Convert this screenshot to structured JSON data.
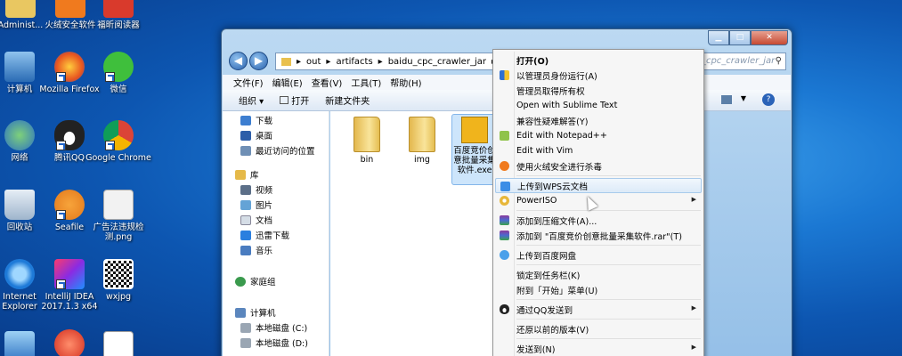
{
  "desktop": {
    "row0": [
      "Administ...",
      "火绒安全软件",
      "福昕阅读器"
    ],
    "row1": [
      "计算机",
      "Mozilla Firefox",
      "微信"
    ],
    "row2": [
      "网络",
      "腾讯QQ",
      "Google Chrome"
    ],
    "row3": [
      "回收站",
      "Seafile",
      "广告法违规检测.png"
    ],
    "row4": [
      "Internet Explorer",
      "IntelliJ IDEA 2017.1.3 x64",
      "wxjpg"
    ]
  },
  "window": {
    "breadcrumb": [
      "out",
      "artifacts",
      "baidu_cpc_crawler_jar"
    ],
    "search_placeholder": "baidu_cpc_crawler_jar",
    "menu": [
      "文件(F)",
      "编辑(E)",
      "查看(V)",
      "工具(T)",
      "帮助(H)"
    ],
    "toolbar": [
      "组织 ▾",
      "打开",
      "新建文件夹"
    ],
    "nav": [
      "下载",
      "桌面",
      "最近访问的位置",
      "库",
      "视频",
      "图片",
      "文档",
      "迅雷下载",
      "音乐",
      "家庭组",
      "计算机",
      "本地磁盘 (C:)",
      "本地磁盘 (D:)"
    ],
    "files": [
      "bin",
      "img",
      "百度竞价创意批量采集软件.exe"
    ]
  },
  "context_menu": {
    "items": [
      {
        "label": "打开(O)",
        "bold": true
      },
      {
        "label": "以管理员身份运行(A)"
      },
      {
        "label": "管理员取得所有权"
      },
      {
        "label": "Open with Sublime Text"
      },
      {
        "label": "兼容性疑难解答(Y)"
      },
      {
        "label": "Edit with Notepad++"
      },
      {
        "label": "Edit with Vim"
      },
      {
        "label": "使用火绒安全进行杀毒"
      },
      {
        "label": "上传到WPS云文档"
      },
      {
        "label": "PowerISO",
        "submenu": true
      },
      {
        "label": "添加到压缩文件(A)..."
      },
      {
        "label": "添加到 \"百度竞价创意批量采集软件.rar\"(T)"
      },
      {
        "label": "上传到百度网盘"
      },
      {
        "label": "锁定到任务栏(K)"
      },
      {
        "label": "附到「开始」菜单(U)"
      },
      {
        "label": "通过QQ发送到",
        "submenu": true
      },
      {
        "label": "还原以前的版本(V)"
      },
      {
        "label": "发送到(N)",
        "submenu": true
      }
    ]
  },
  "colors": {
    "accent": "#1e63c7",
    "highlight": "#dceaf8"
  }
}
